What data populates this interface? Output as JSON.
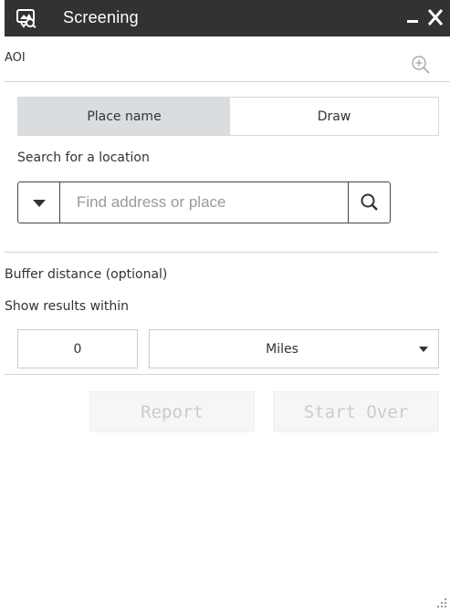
{
  "window": {
    "title": "Screening",
    "app_icon": "map-screen-icon",
    "minimize_icon": "minimize-icon",
    "close_icon": "close-icon"
  },
  "aoi": {
    "label": "AOI",
    "zoom_icon": "zoom-in-icon"
  },
  "tabs": [
    {
      "label": "Place name",
      "active": true
    },
    {
      "label": "Draw",
      "active": false
    }
  ],
  "search": {
    "label": "Search for a location",
    "placeholder": "Find address or place",
    "value": "",
    "dropdown_icon": "caret-down-icon",
    "search_icon": "search-icon"
  },
  "buffer": {
    "label": "Buffer distance (optional)",
    "within_label": "Show results within",
    "distance_value": "0",
    "unit_selected": "Miles"
  },
  "actions": {
    "report_label": "Report",
    "start_over_label": "Start Over",
    "enabled": false
  },
  "colors": {
    "titlebar": "#323232",
    "active_tab": "#d9dde0",
    "disabled_text": "#cbcbcb"
  }
}
